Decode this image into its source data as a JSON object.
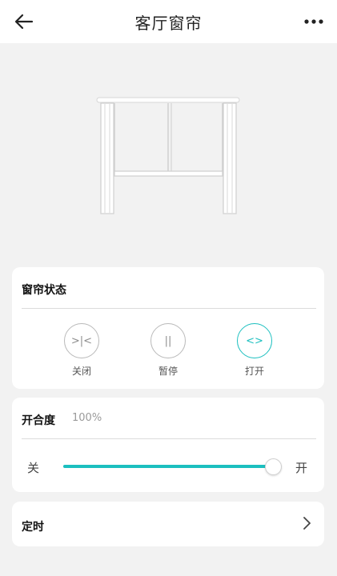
{
  "header": {
    "title": "客厅窗帘"
  },
  "status_card": {
    "heading": "窗帘状态",
    "controls": [
      {
        "label": "关闭",
        "glyph": ">|<",
        "active": false
      },
      {
        "label": "暂停",
        "glyph": "||",
        "active": false
      },
      {
        "label": "打开",
        "glyph": "<>",
        "active": true
      }
    ]
  },
  "openness_card": {
    "heading": "开合度",
    "value_text": "100%",
    "value": 1.0,
    "min_label": "关",
    "max_label": "开"
  },
  "timer_card": {
    "label": "定时"
  },
  "colors": {
    "accent": "#1bbfbf",
    "background": "#f2f2f2",
    "card": "#ffffff"
  },
  "icons": {
    "back": "arrow-left-icon",
    "more": "more-dots-icon",
    "chevron": "chevron-right-icon"
  }
}
